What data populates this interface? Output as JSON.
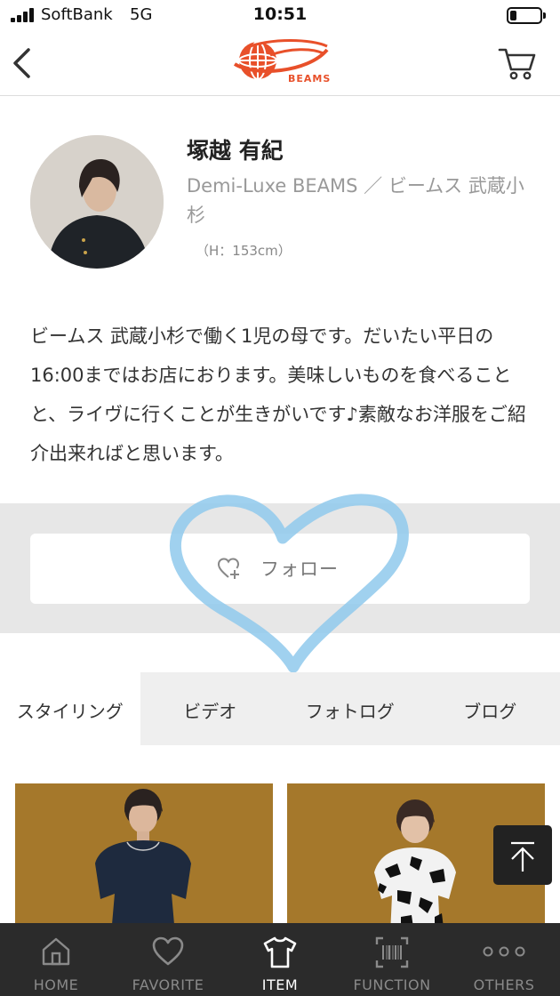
{
  "status_bar": {
    "carrier": "SoftBank",
    "network": "5G",
    "time": "10:51",
    "battery_level": 0.22
  },
  "header": {
    "back_icon": "chevron-left-icon",
    "logo_text": "BEAMS",
    "cart_icon": "cart-icon",
    "brand_color": "#e8502a"
  },
  "profile": {
    "name": "塚越 有紀",
    "shop": "Demi-Luxe BEAMS ／ ビームス 武蔵小杉",
    "height": "（H：153cm）",
    "bio": "ビームス 武蔵小杉で働く1児の母です。だいたい平日の16:00まではお店におります。美味しいものを食べることと、ライヴに行くことが生きがいです♪素敵なお洋服をご紹介出来ればと思います。"
  },
  "follow": {
    "label": "フォロー",
    "icon": "heart-plus-icon"
  },
  "tabs": [
    {
      "label": "スタイリング",
      "active": true
    },
    {
      "label": "ビデオ",
      "active": false
    },
    {
      "label": "フォトログ",
      "active": false
    },
    {
      "label": "ブログ",
      "active": false
    }
  ],
  "scroll_top_icon": "arrow-up-to-top-icon",
  "bottom_nav": [
    {
      "label": "HOME",
      "icon": "home-icon",
      "active": false
    },
    {
      "label": "FAVORITE",
      "icon": "heart-icon",
      "active": false
    },
    {
      "label": "ITEM",
      "icon": "tshirt-icon",
      "active": true
    },
    {
      "label": "FUNCTION",
      "icon": "barcode-icon",
      "active": false
    },
    {
      "label": "OTHERS",
      "icon": "more-dots-icon",
      "active": false
    }
  ]
}
